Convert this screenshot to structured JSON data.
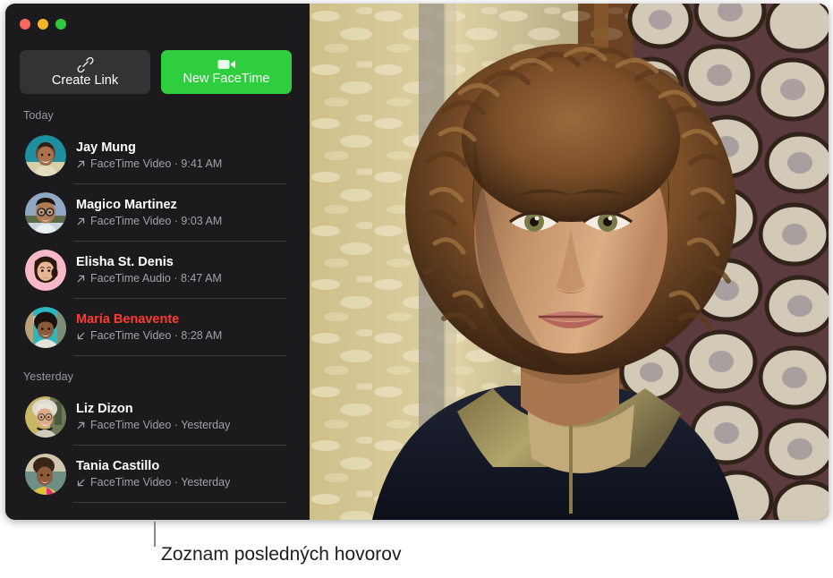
{
  "window": {
    "traffic_lights": [
      {
        "name": "close",
        "color": "#f9685f"
      },
      {
        "name": "minimize",
        "color": "#f7b32c"
      },
      {
        "name": "zoom",
        "color": "#2fc83f"
      }
    ]
  },
  "toolbar": {
    "create_link_label": "Create Link",
    "create_link_icon": "link-icon",
    "new_facetime_label": "New FaceTime",
    "new_facetime_icon": "video-camera-icon",
    "accent_green": "#2ece3f"
  },
  "call_list": {
    "sections": [
      {
        "header": "Today",
        "calls": [
          {
            "name": "Jay Mung",
            "kind": "FaceTime Video",
            "time": "9:41 AM",
            "meta": "FaceTime Video · 9:41 AM",
            "direction": "outgoing",
            "direction_icon": "arrow-up-right-icon",
            "missed": false,
            "avatar_bg": "#1d8f9e"
          },
          {
            "name": "Magico Martinez",
            "kind": "FaceTime Video",
            "time": "9:03 AM",
            "meta": "FaceTime Video · 9:03 AM",
            "direction": "outgoing",
            "direction_icon": "arrow-up-right-icon",
            "missed": false,
            "avatar_bg": "#8fa9c4"
          },
          {
            "name": "Elisha St. Denis",
            "kind": "FaceTime Audio",
            "time": "8:47 AM",
            "meta": "FaceTime Audio · 8:47 AM",
            "direction": "outgoing",
            "direction_icon": "arrow-up-right-icon",
            "missed": false,
            "avatar_bg": "#f7b8c8"
          },
          {
            "name": "María Benavente",
            "kind": "FaceTime Video",
            "time": "8:28 AM",
            "meta": "FaceTime Video · 8:28 AM",
            "direction": "incoming",
            "direction_icon": "arrow-down-left-icon",
            "missed": true,
            "avatar_bg": "#2fb5bd"
          }
        ]
      },
      {
        "header": "Yesterday",
        "calls": [
          {
            "name": "Liz Dizon",
            "kind": "FaceTime Video",
            "time": "Yesterday",
            "meta": "FaceTime Video · Yesterday",
            "direction": "outgoing",
            "direction_icon": "arrow-up-right-icon",
            "missed": false,
            "avatar_bg": "#c8b765"
          },
          {
            "name": "Tania Castillo",
            "kind": "FaceTime Video",
            "time": "Yesterday",
            "meta": "FaceTime Video · Yesterday",
            "direction": "incoming",
            "direction_icon": "arrow-down-left-icon",
            "missed": false,
            "avatar_bg": "#6e8f86"
          }
        ]
      }
    ],
    "missed_color": "#ff3b30"
  },
  "video_pane": {
    "description": "Portrait of a person with curly hair in front of a patterned wall"
  },
  "callout": {
    "text": "Zoznam posledných hovorov"
  }
}
